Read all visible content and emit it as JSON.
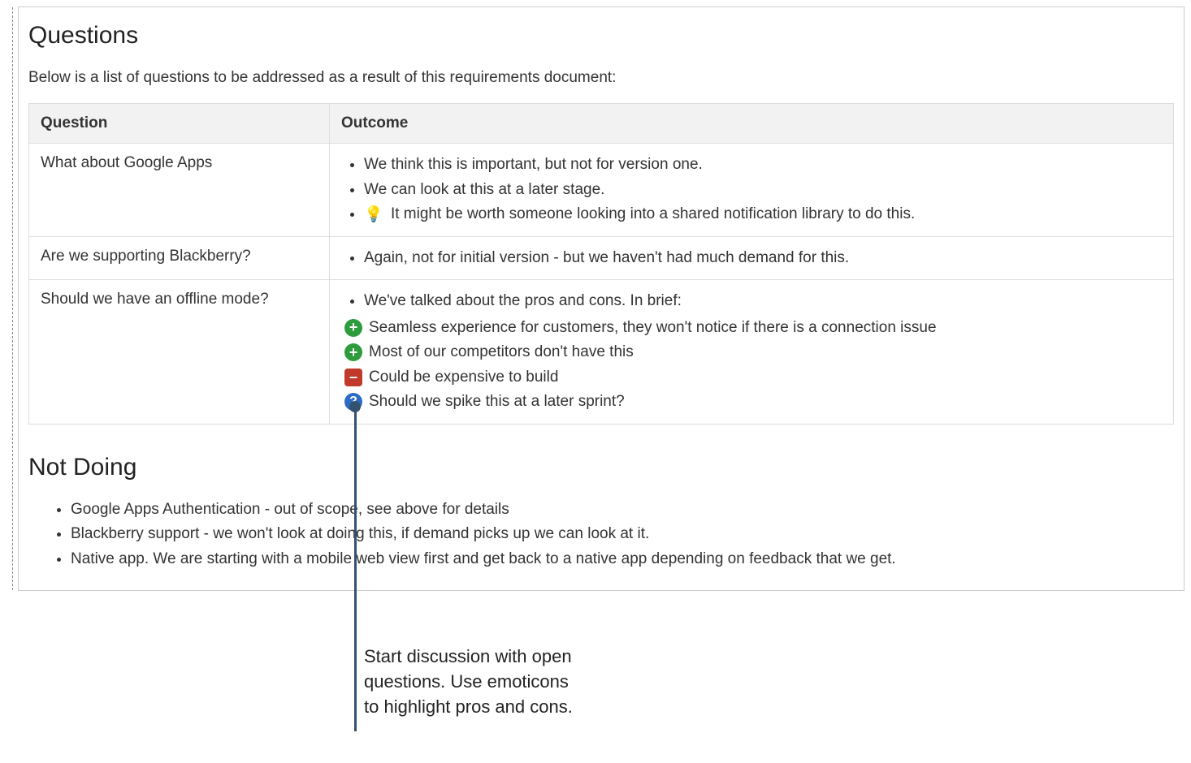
{
  "sections": {
    "questions": {
      "heading": "Questions",
      "intro": "Below is a list of questions to be addressed as a result of this requirements document:",
      "columns": {
        "q": "Question",
        "o": "Outcome"
      },
      "rows": [
        {
          "question": "What about Google Apps",
          "outcomes": [
            {
              "type": "bullet",
              "text": "We think this is important, but not for version one."
            },
            {
              "type": "bullet",
              "text": "We can look at this at a later stage."
            },
            {
              "type": "bullet-bulb",
              "text": "It might be worth someone looking into a shared notification library to do this."
            }
          ]
        },
        {
          "question": "Are we supporting Blackberry?",
          "outcomes": [
            {
              "type": "bullet",
              "text": "Again, not for initial version - but we haven't had much demand for this."
            }
          ]
        },
        {
          "question": "Should we have an offline mode?",
          "outcomes": [
            {
              "type": "bullet",
              "text": "We've talked about the pros and cons. In brief:"
            },
            {
              "type": "plus",
              "text": "Seamless experience for customers, they won't notice if there is a connection issue"
            },
            {
              "type": "plus",
              "text": "Most of our competitors don't have this"
            },
            {
              "type": "minus",
              "text": "Could be expensive to build"
            },
            {
              "type": "quest",
              "text": "Should we spike this at a later sprint?"
            }
          ]
        }
      ]
    },
    "not_doing": {
      "heading": "Not Doing",
      "items": [
        "Google Apps Authentication - out of scope, see above for details",
        "Blackberry support - we won't look at doing this, if demand picks up we can look at it.",
        "Native app. We are starting with a mobile web view first and get back to a native app depending on feedback that we get."
      ]
    }
  },
  "callout": {
    "line1": "Start discussion with open",
    "line2": "questions. Use emoticons",
    "line3": "to highlight pros and cons."
  }
}
